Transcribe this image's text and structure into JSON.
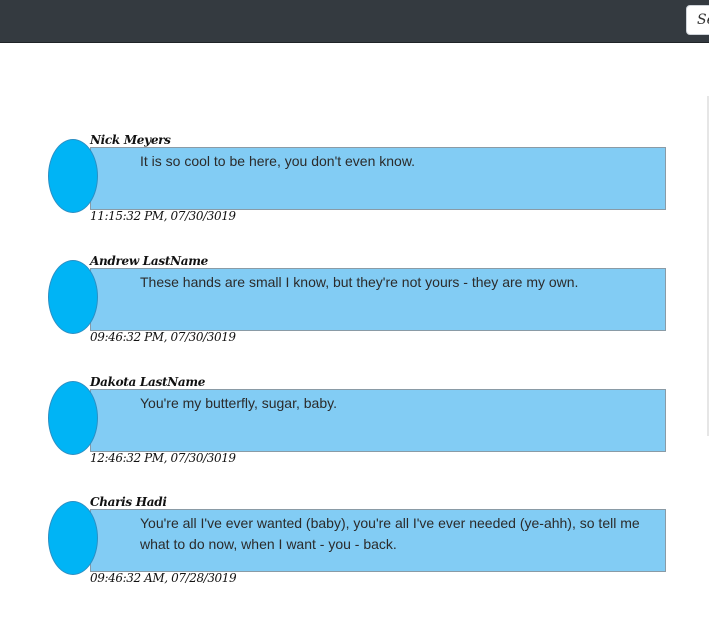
{
  "topbar": {
    "button_label": "Se"
  },
  "posts": [
    {
      "name": "Nick Meyers",
      "message": "It is so cool to be here, you don't even know.",
      "timestamp": "11:15:32 PM, 07/30/3019"
    },
    {
      "name": "Andrew LastName",
      "message": "These hands are small I know, but they're not yours - they are my own.",
      "timestamp": "09:46:32 PM, 07/30/3019"
    },
    {
      "name": "Dakota LastName",
      "message": "You're my butterfly, sugar, baby.",
      "timestamp": "12:46:32 PM, 07/30/3019"
    },
    {
      "name": "Charis Hadi",
      "message": "You're all I've ever wanted (baby), you're all I've ever needed (ye-ahh), so tell me what to do now, when I want - you - back.",
      "timestamp": "09:46:32 AM, 07/28/3019"
    }
  ]
}
